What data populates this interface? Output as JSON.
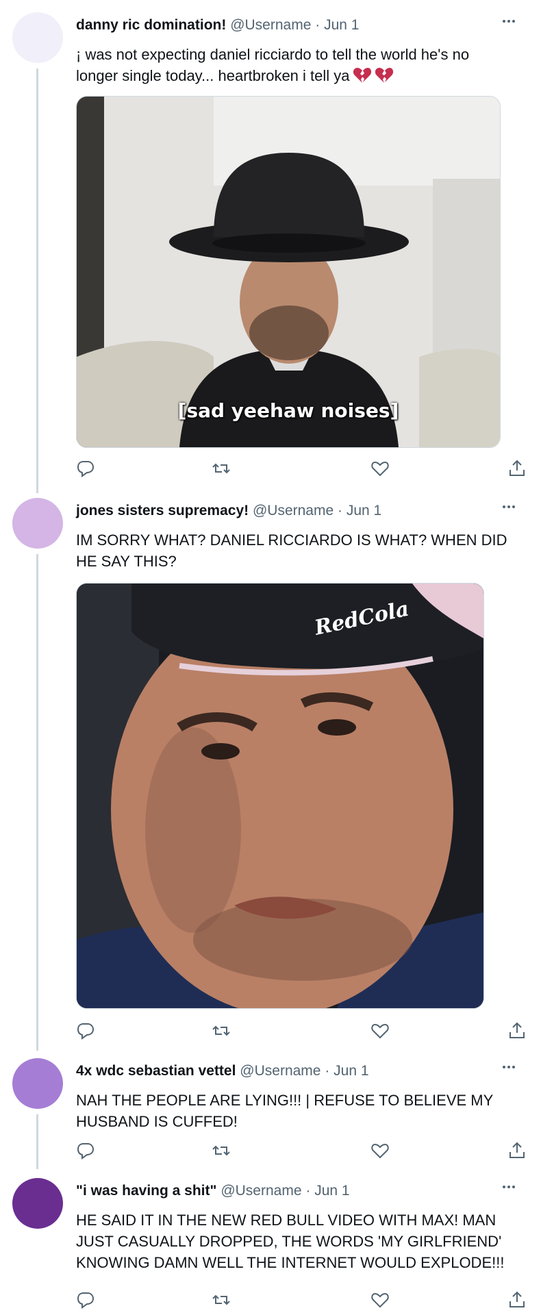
{
  "tweets": [
    {
      "display_name": "danny ric domination!",
      "handle": "@Username",
      "date": "Jun 1",
      "avatar_color": "#f1effa",
      "text": "¡ was not expecting daniel ricciardo to tell the world he's no longer single today... heartbroken i tell ya",
      "emoji": [
        "broken-heart-icon",
        "broken-heart-icon"
      ],
      "media": {
        "caption": "[sad yeehaw noises]"
      }
    },
    {
      "display_name": "jones sisters supremacy!",
      "handle": "@Username",
      "date": "Jun 1",
      "avatar_color": "#d4b5e6",
      "text": "IM SORRY WHAT? DANIEL RICCIARDO IS WHAT? WHEN DID HE SAY THIS?",
      "media": {
        "cap_logo": "RedCola"
      }
    },
    {
      "display_name": "4x wdc sebastian vettel",
      "handle": "@Username",
      "date": "Jun 1",
      "avatar_color": "#a57dd5",
      "text": "NAH THE PEOPLE ARE LYING!!! | REFUSE TO BELIEVE MY HUSBAND IS CUFFED!"
    },
    {
      "display_name": "\"i was having a shit\"",
      "handle": "@Username",
      "date": "Jun 1",
      "avatar_color": "#6a2e91",
      "text": "HE SAID IT IN THE NEW RED BULL VIDEO WITH MAX! MAN JUST CASUALLY DROPPED, THE WORDS 'MY GIRLFRIEND' KNOWING DAMN WELL THE INTERNET WOULD EXPLODE!!!"
    }
  ],
  "separator": "·",
  "action_icons": [
    "reply-icon",
    "retweet-icon",
    "like-icon",
    "share-icon"
  ],
  "colors": {
    "text": "#0f1419",
    "secondary": "#536471",
    "thread_line": "#cfd9de",
    "border": "#cfd9de"
  }
}
